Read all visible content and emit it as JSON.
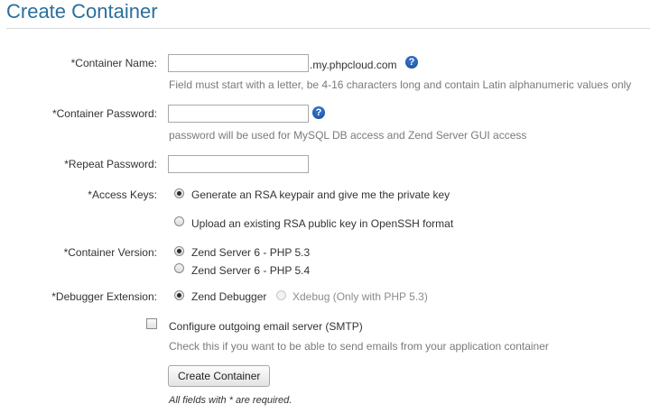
{
  "page": {
    "title": "Create Container"
  },
  "form": {
    "container_name": {
      "label": "*Container Name:",
      "value": "",
      "suffix": ".my.phpcloud.com",
      "hint": "Field must start with a letter, be 4-16 characters long and contain Latin alphanumeric values only"
    },
    "container_password": {
      "label": "*Container Password:",
      "value": "",
      "hint": "password will be used for MySQL DB access and Zend Server GUI access"
    },
    "repeat_password": {
      "label": "*Repeat Password:",
      "value": ""
    },
    "access_keys": {
      "label": "*Access Keys:",
      "options": [
        {
          "label": "Generate an RSA keypair and give me the private key",
          "checked": true
        },
        {
          "label": "Upload an existing RSA public key in OpenSSH format",
          "checked": false
        }
      ]
    },
    "container_version": {
      "label": "*Container Version:",
      "options": [
        {
          "label": "Zend Server 6 - PHP 5.3",
          "checked": true
        },
        {
          "label": "Zend Server 6 - PHP 5.4",
          "checked": false
        }
      ]
    },
    "debugger_extension": {
      "label": "*Debugger Extension:",
      "options": [
        {
          "label": "Zend Debugger",
          "checked": true,
          "disabled": false
        },
        {
          "label": "Xdebug (Only with PHP 5.3)",
          "checked": false,
          "disabled": true
        }
      ]
    },
    "smtp": {
      "label": "Configure outgoing email server (SMTP)",
      "checked": false,
      "hint": "Check this if you want to be able to send emails from your application container"
    },
    "submit_label": "Create Container",
    "required_note": "All fields with * are required."
  },
  "icons": {
    "help": "question-mark-icon"
  },
  "colors": {
    "title": "#2a6f9e",
    "help_icon": "#2f6dc4",
    "hint_text": "#7a7a7a"
  }
}
